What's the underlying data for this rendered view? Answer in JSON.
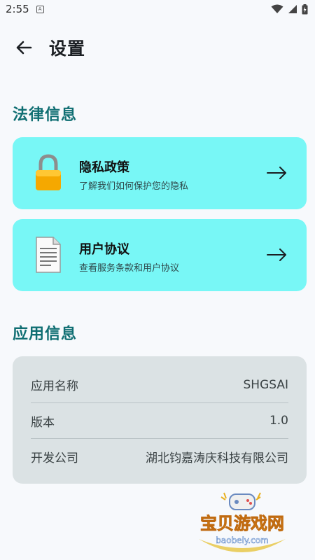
{
  "status_bar": {
    "time": "2:55",
    "notification_glyph": "A",
    "icons": [
      "wifi-icon",
      "signal-icon",
      "battery-icon"
    ]
  },
  "header": {
    "back_icon": "arrow-left-icon",
    "title": "设置"
  },
  "legal_section": {
    "title": "法律信息",
    "items": [
      {
        "icon": "lock-icon",
        "title": "隐私政策",
        "subtitle": "了解我们如何保护您的隐私",
        "arrow_icon": "arrow-right-icon"
      },
      {
        "icon": "document-icon",
        "title": "用户协议",
        "subtitle": "查看服务条款和用户协议",
        "arrow_icon": "arrow-right-icon"
      }
    ]
  },
  "app_section": {
    "title": "应用信息",
    "rows": [
      {
        "label": "应用名称",
        "value": "SHGSAI"
      },
      {
        "label": "版本",
        "value": "1.0"
      },
      {
        "label": "开发公司",
        "value": "湖北钧嘉涛庆科技有限公司"
      }
    ]
  },
  "watermark": {
    "text": "宝贝游戏网",
    "url": "baobeiy.com"
  },
  "colors": {
    "accent": "#0f6e72",
    "card_bg": "#78f7f6",
    "info_bg": "#dbe2e4",
    "page_bg": "#f7f9fc"
  }
}
